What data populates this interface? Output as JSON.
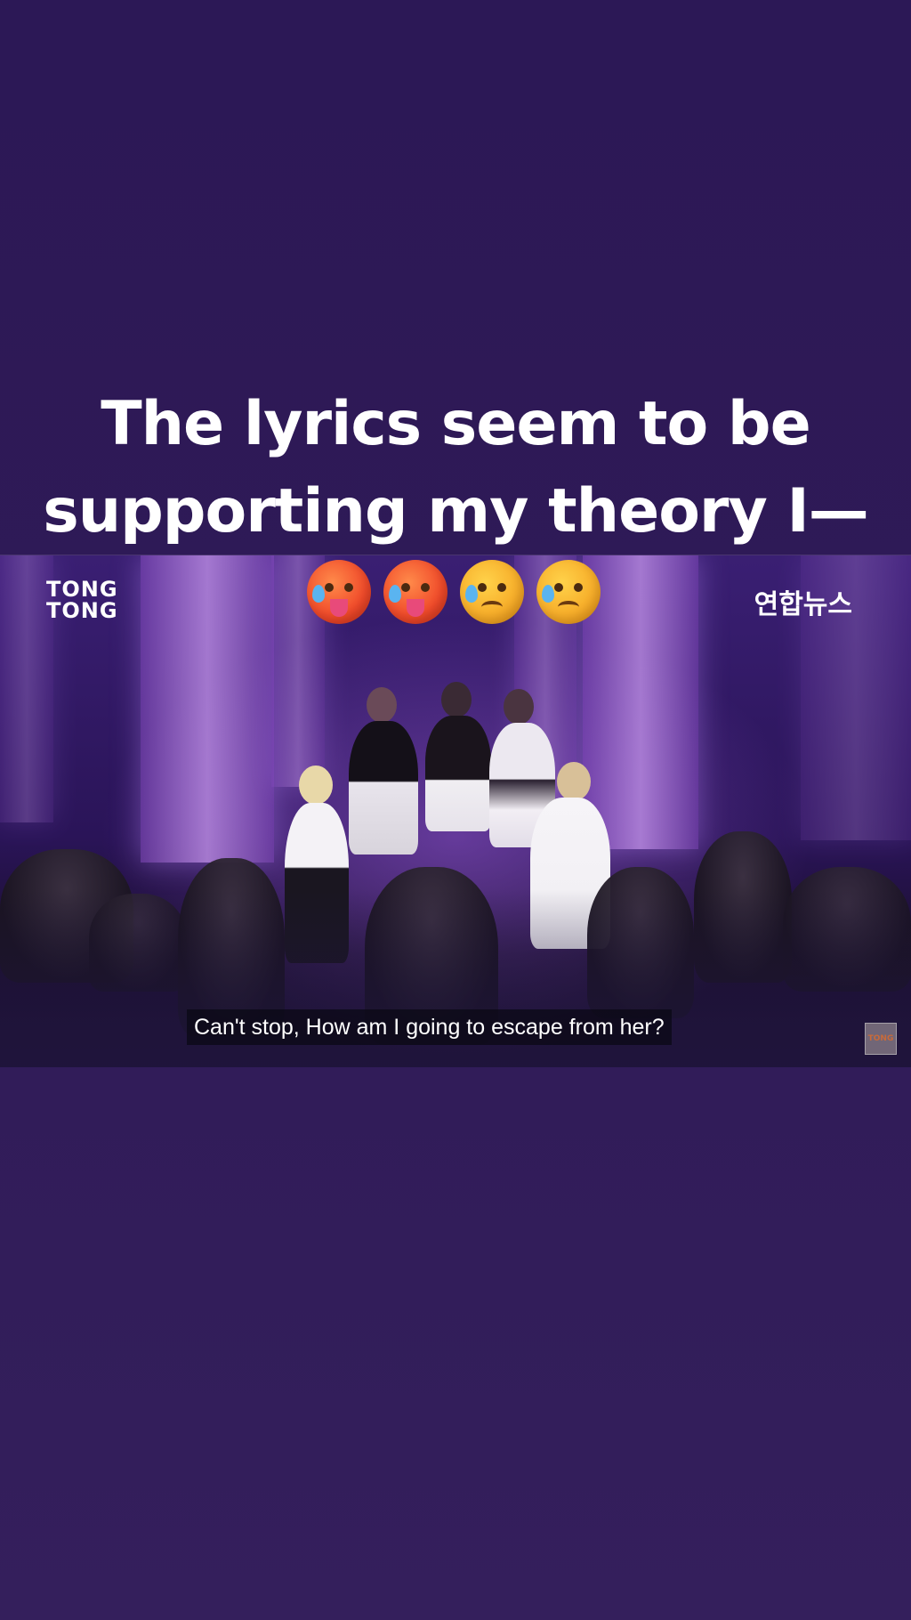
{
  "post": {
    "caption_line1": "The lyrics seem to be",
    "caption_line2": "supporting my theory I—"
  },
  "video": {
    "brand_left_line1": "TONG",
    "brand_left_line2": "TONG",
    "brand_right": "연합뉴스",
    "emojis": [
      "hot-face",
      "hot-face",
      "sad-but-relieved-face",
      "sad-but-relieved-face"
    ],
    "subtitle": "Can't stop, How am I going to escape from her?",
    "corner_badge": "TONG"
  },
  "colors": {
    "background": "#2f1a57",
    "stage_purple": "#3a1f73",
    "caption_text": "#ffffff"
  }
}
